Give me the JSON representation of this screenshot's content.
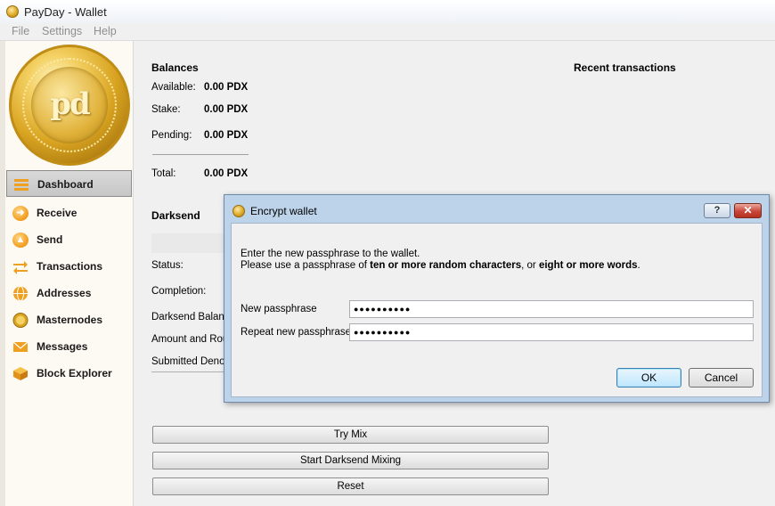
{
  "window": {
    "title": "PayDay - Wallet"
  },
  "menu": [
    "File",
    "Settings",
    "Help"
  ],
  "logo_text": "pd",
  "sidebar": {
    "items": [
      {
        "label": "Dashboard",
        "icon": "dashboard-icon",
        "active": true
      },
      {
        "label": "Receive",
        "icon": "receive-icon"
      },
      {
        "label": "Send",
        "icon": "send-icon"
      },
      {
        "label": "Transactions",
        "icon": "transactions-icon"
      },
      {
        "label": "Addresses",
        "icon": "addresses-icon"
      },
      {
        "label": "Masternodes",
        "icon": "masternodes-icon"
      },
      {
        "label": "Messages",
        "icon": "messages-icon"
      },
      {
        "label": "Block Explorer",
        "icon": "block-explorer-icon"
      }
    ]
  },
  "balances": {
    "heading": "Balances",
    "available_label": "Available:",
    "available_value": "0.00 PDX",
    "stake_label": "Stake:",
    "stake_value": "0.00 PDX",
    "pending_label": "Pending:",
    "pending_value": "0.00 PDX",
    "total_label": "Total:",
    "total_value": "0.00 PDX"
  },
  "recent": {
    "heading": "Recent transactions"
  },
  "darksend": {
    "heading": "Darksend",
    "status_label": "Status:",
    "completion_label": "Completion:",
    "balance_label": "Darksend Balance",
    "amount_label": "Amount and Rour",
    "submitted_label": "Submitted Denom",
    "try_mix": "Try Mix",
    "start_mixing": "Start Darksend Mixing",
    "reset": "Reset"
  },
  "dialog": {
    "title": "Encrypt wallet",
    "help": "?",
    "close": "✕",
    "intro_line1": "Enter the new passphrase to the wallet.",
    "intro_pre": "Please use a passphrase of ",
    "intro_bold1": "ten or more random characters",
    "intro_mid": ", or ",
    "intro_bold2": "eight or more words",
    "intro_end": ".",
    "new_label": "New passphrase",
    "new_value": "●●●●●●●●●●",
    "repeat_label": "Repeat new passphrase",
    "repeat_value": "●●●●●●●●●●",
    "ok": "OK",
    "cancel": "Cancel"
  }
}
